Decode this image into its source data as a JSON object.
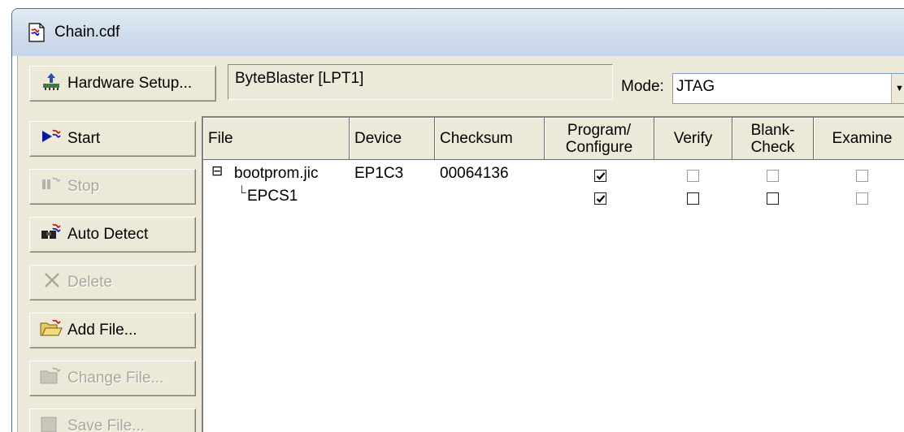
{
  "window": {
    "title": "Chain.cdf",
    "icon": "cdf-file-icon"
  },
  "toolbar": {
    "hardware_setup_label": "Hardware Setup...",
    "hardware_value": "ByteBlaster [LPT1]",
    "mode_label": "Mode:",
    "mode_value": "JTAG"
  },
  "sidebar": {
    "buttons": [
      {
        "label": "Start",
        "icon": "start-icon",
        "enabled": true
      },
      {
        "label": "Stop",
        "icon": "stop-icon",
        "enabled": false
      },
      {
        "label": "Auto Detect",
        "icon": "auto-detect-icon",
        "enabled": true
      },
      {
        "label": "Delete",
        "icon": "delete-x-icon",
        "enabled": false
      },
      {
        "label": "Add File...",
        "icon": "add-file-folder-icon",
        "enabled": true
      },
      {
        "label": "Change File...",
        "icon": "change-file-icon",
        "enabled": false
      },
      {
        "label": "Save File...",
        "icon": "save-file-icon",
        "enabled": false
      }
    ]
  },
  "grid": {
    "columns": {
      "file": "File",
      "device": "Device",
      "checksum": "Checksum",
      "program_line1": "Program/",
      "program_line2": "Configure",
      "verify": "Verify",
      "blank_line1": "Blank-",
      "blank_line2": "Check",
      "examine": "Examine"
    },
    "rows": [
      {
        "expander": "⊟",
        "file": "bootprom.jic",
        "device": "EP1C3",
        "checksum": "00064136",
        "program": "checked",
        "verify": "disabled",
        "blank_check": "disabled",
        "examine": "disabled"
      },
      {
        "tree_prefix": "└",
        "file": "EPCS1",
        "device": "",
        "checksum": "",
        "program": "checked",
        "verify": "unchecked",
        "blank_check": "unchecked",
        "examine": "disabled"
      }
    ]
  },
  "colors": {
    "titlebar": "#cfdcec",
    "face": "#ece9d8",
    "combo_border": "#7f9db9"
  }
}
